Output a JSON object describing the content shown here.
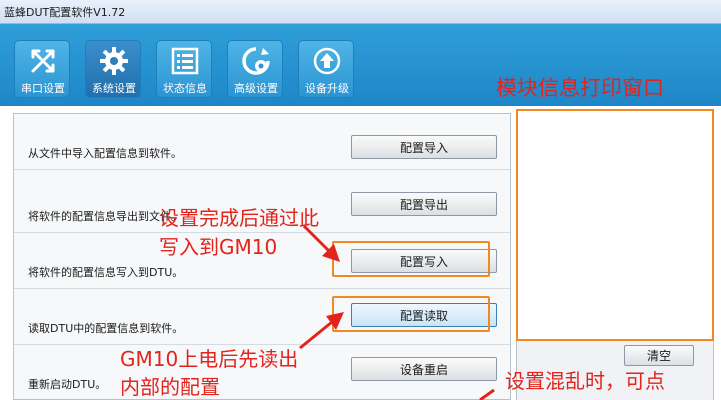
{
  "window": {
    "title": "蓝蜂DUT配置软件V1.72"
  },
  "toolbar": {
    "items": [
      {
        "label": "串口设置",
        "icon": "crossed-arrows-icon"
      },
      {
        "label": "系统设置",
        "icon": "gear-icon"
      },
      {
        "label": "状态信息",
        "icon": "list-icon"
      },
      {
        "label": "高级设置",
        "icon": "refresh-gear-icon"
      },
      {
        "label": "设备升级",
        "icon": "upload-icon"
      }
    ],
    "active_index": 1
  },
  "module_panel": {
    "title": "模块信息打印窗口",
    "clear_label": "清空"
  },
  "config_rows": [
    {
      "description": "从文件中导入配置信息到软件。",
      "button": "配置导入"
    },
    {
      "description": "将软件的配置信息导出到文件。",
      "button": "配置导出"
    },
    {
      "description": "将软件的配置信息写入到DTU。",
      "button": "配置写入"
    },
    {
      "description": "读取DTU中的配置信息到软件。",
      "button": "配置读取"
    },
    {
      "description": "重新启动DTU。",
      "button": "设备重启"
    }
  ],
  "annotations": {
    "write": [
      "设置完成后通过此",
      "写入到GM10"
    ],
    "read": [
      "GM10上电后先读出",
      "内部的配置"
    ],
    "reset": "设置混乱时，可点"
  },
  "colors": {
    "annotation": "#e2241c",
    "highlight": "#f08a20",
    "header": "#2393d0"
  }
}
